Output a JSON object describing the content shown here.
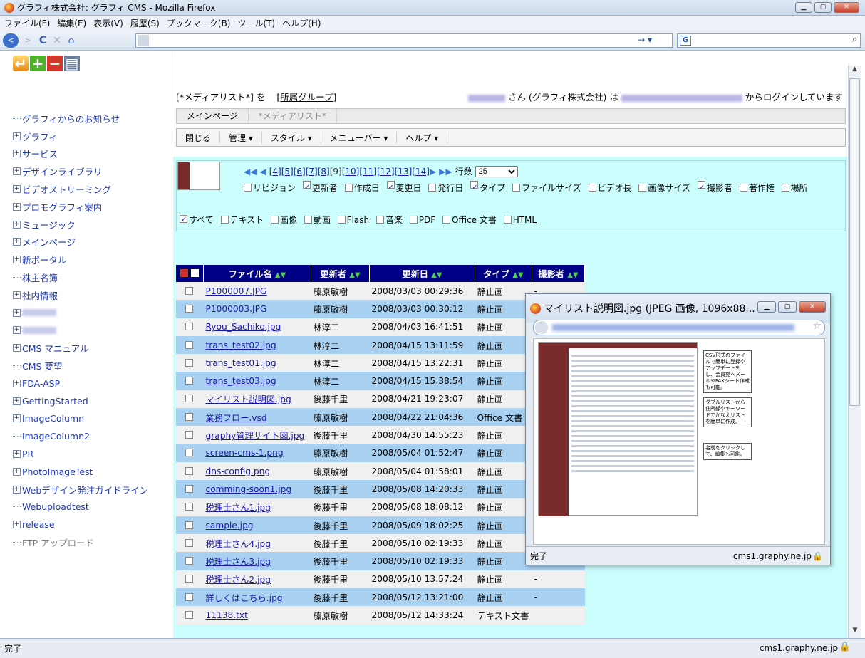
{
  "window": {
    "title": "グラフィ株式会社: グラフィ CMS - Mozilla Firefox"
  },
  "menu": [
    "ファイル(F)",
    "編集(E)",
    "表示(V)",
    "履歴(S)",
    "ブックマーク(B)",
    "ツール(T)",
    "ヘルプ(H)"
  ],
  "nav": {
    "back": "<",
    "forward": ">",
    "reload": "C",
    "stop": "✕",
    "home": "⌂",
    "go": "→ ▾"
  },
  "search": {
    "engine": "G",
    "icon": "⌕"
  },
  "sidebar": {
    "tools": [
      "folder-up",
      "add",
      "remove",
      "print"
    ],
    "tree": [
      {
        "label": "グラフィからのお知らせ",
        "exp": false
      },
      {
        "label": "グラフィ",
        "exp": true
      },
      {
        "label": "サービス",
        "exp": true
      },
      {
        "label": "デザインライブラリ",
        "exp": true
      },
      {
        "label": "ビデオストリーミング",
        "exp": true
      },
      {
        "label": "プロモグラフィ案内",
        "exp": true
      },
      {
        "label": "ミュージック",
        "exp": true
      },
      {
        "label": "メインページ",
        "exp": true
      },
      {
        "label": "新ポータル",
        "exp": true
      },
      {
        "label": "株主名簿",
        "exp": false
      },
      {
        "label": "社内情報",
        "exp": true
      },
      {
        "label": "",
        "exp": true,
        "blur": true
      },
      {
        "label": "",
        "exp": true,
        "blur": true
      },
      {
        "label": "CMS マニュアル",
        "exp": true
      },
      {
        "label": "CMS 要望",
        "exp": false
      },
      {
        "label": "FDA-ASP",
        "exp": true
      },
      {
        "label": "GettingStarted",
        "exp": true
      },
      {
        "label": "ImageColumn",
        "exp": true
      },
      {
        "label": "ImageColumn2",
        "exp": false
      },
      {
        "label": "PR",
        "exp": true
      },
      {
        "label": "PhotoImageTest",
        "exp": true
      },
      {
        "label": "Webデザイン発注ガイドライン",
        "exp": true
      },
      {
        "label": "Webuploadtest",
        "exp": false
      },
      {
        "label": "release",
        "exp": true
      },
      {
        "label": "FTP アップロード",
        "exp": false,
        "gray": true
      }
    ]
  },
  "content": {
    "login": {
      "list": "[*メディアリスト*] を",
      "group": "[所属グループ]",
      "suffix_user": "さん (グラフィ株式会社) は",
      "suffix_end": "からログインしています"
    },
    "tabs": [
      "メインページ",
      "*メディアリスト*"
    ],
    "toolbar": [
      "閉じる",
      "管理 ▾",
      "スタイル ▾",
      "メニューバー ▾",
      "ヘルプ ▾"
    ],
    "pager": {
      "pages": [
        "[4]",
        "[5]",
        "[6]",
        "[7]",
        "[8]",
        "[9]",
        "[10]",
        "[11]",
        "[12]",
        "[13]",
        "[14]"
      ],
      "current": "[9]",
      "rows_label": "行数",
      "rows_value": "25"
    },
    "columns": [
      {
        "label": "リビジョン",
        "on": false
      },
      {
        "label": "更新者",
        "on": true
      },
      {
        "label": "作成日",
        "on": false
      },
      {
        "label": "変更日",
        "on": true
      },
      {
        "label": "発行日",
        "on": false
      },
      {
        "label": "タイプ",
        "on": true
      },
      {
        "label": "ファイルサイズ",
        "on": false
      },
      {
        "label": "ビデオ長",
        "on": false
      },
      {
        "label": "画像サイズ",
        "on": false
      },
      {
        "label": "撮影者",
        "on": true
      },
      {
        "label": "著作権",
        "on": false
      },
      {
        "label": "場所",
        "on": false
      }
    ],
    "types": [
      {
        "label": "すべて",
        "on": true
      },
      {
        "label": "テキスト",
        "on": false
      },
      {
        "label": "画像",
        "on": false
      },
      {
        "label": "動画",
        "on": false
      },
      {
        "label": "Flash",
        "on": false
      },
      {
        "label": "音楽",
        "on": false
      },
      {
        "label": "PDF",
        "on": false
      },
      {
        "label": "Office 文書",
        "on": false
      },
      {
        "label": "HTML",
        "on": false
      }
    ],
    "grid": {
      "headers": [
        "ファイル名",
        "更新者",
        "更新日",
        "タイプ",
        "撮影者"
      ],
      "rows": [
        [
          "P1000007.JPG",
          "藤原敏樹",
          "2008/03/03 00:29:36",
          "静止画",
          "-"
        ],
        [
          "P1000003.JPG",
          "藤原敏樹",
          "2008/03/03 00:30:12",
          "静止画",
          ""
        ],
        [
          "Ryou_Sachiko.jpg",
          "林淳二",
          "2008/04/03 16:41:51",
          "静止画",
          ""
        ],
        [
          "trans_test02.jpg",
          "林淳二",
          "2008/04/15 13:11:59",
          "静止画",
          ""
        ],
        [
          "trans_test01.jpg",
          "林淳二",
          "2008/04/15 13:22:31",
          "静止画",
          ""
        ],
        [
          "trans_test03.jpg",
          "林淳二",
          "2008/04/15 15:38:54",
          "静止画",
          ""
        ],
        [
          "マイリスト説明図.jpg",
          "後藤千里",
          "2008/04/21 19:23:07",
          "静止画",
          ""
        ],
        [
          "業務フロー.vsd",
          "藤原敏樹",
          "2008/04/22 21:04:36",
          "Office 文書",
          ""
        ],
        [
          "graphy管理サイト図.jpg",
          "後藤千里",
          "2008/04/30 14:55:23",
          "静止画",
          ""
        ],
        [
          "screen-cms-1.png",
          "藤原敏樹",
          "2008/05/04 01:52:47",
          "静止画",
          ""
        ],
        [
          "dns-config.png",
          "藤原敏樹",
          "2008/05/04 01:58:01",
          "静止画",
          ""
        ],
        [
          "comming-soon1.jpg",
          "後藤千里",
          "2008/05/08 14:20:33",
          "静止画",
          ""
        ],
        [
          "税理士さん1.jpg",
          "後藤千里",
          "2008/05/08 18:08:12",
          "静止画",
          ""
        ],
        [
          "sample.jpg",
          "後藤千里",
          "2008/05/09 18:02:25",
          "静止画",
          ""
        ],
        [
          "税理士さん4.jpg",
          "後藤千里",
          "2008/05/10 02:19:33",
          "静止画",
          "-"
        ],
        [
          "税理士さん3.jpg",
          "後藤千里",
          "2008/05/10 02:19:33",
          "静止画",
          "-"
        ],
        [
          "税理士さん2.jpg",
          "後藤千里",
          "2008/05/10 13:57:24",
          "静止画",
          "-"
        ],
        [
          "詳しくはこちら.jpg",
          "後藤千里",
          "2008/05/12 13:21:00",
          "静止画",
          "-"
        ],
        [
          "11138.txt",
          "藤原敏樹",
          "2008/05/12 14:33:24",
          "テキスト文書",
          ""
        ]
      ]
    }
  },
  "popup": {
    "title": "マイリスト説明図.jpg (JPEG 画像, 1096x88...",
    "status": "完了",
    "host": "cms1.graphy.ne.jp",
    "callouts": [
      "CSV形式のファイルで簡単に登録やアップデートをし、会員宛へメールやFAXシート作成も可能。",
      "ダブルリストから住所録やキーワードでかなえリストを簡単に作成。",
      "名前をクリックして、編集も可能。"
    ]
  },
  "status": {
    "text": "完了",
    "host": "cms1.graphy.ne.jp"
  }
}
